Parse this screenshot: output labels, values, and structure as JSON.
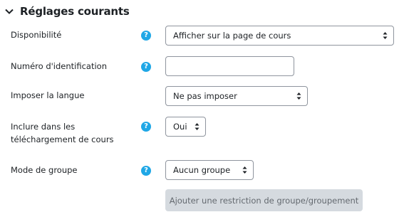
{
  "section": {
    "title": "Réglages courants"
  },
  "fields": {
    "availability": {
      "label": "Disponibilité",
      "value": "Afficher sur la page de cours"
    },
    "idnumber": {
      "label": "Numéro d'identification",
      "value": ""
    },
    "language": {
      "label": "Imposer la langue",
      "value": "Ne pas imposer"
    },
    "download": {
      "label": "Inclure dans les téléchargement de cours",
      "value": "Oui"
    },
    "groupmode": {
      "label": "Mode de groupe",
      "value": "Aucun groupe"
    }
  },
  "help_glyph": "?",
  "group_restriction_button": "Ajouter une restriction de groupe/groupement",
  "colors": {
    "help_icon": "#1fa7e6",
    "border": "#8f959e",
    "disabled_button": "#ced4da"
  }
}
